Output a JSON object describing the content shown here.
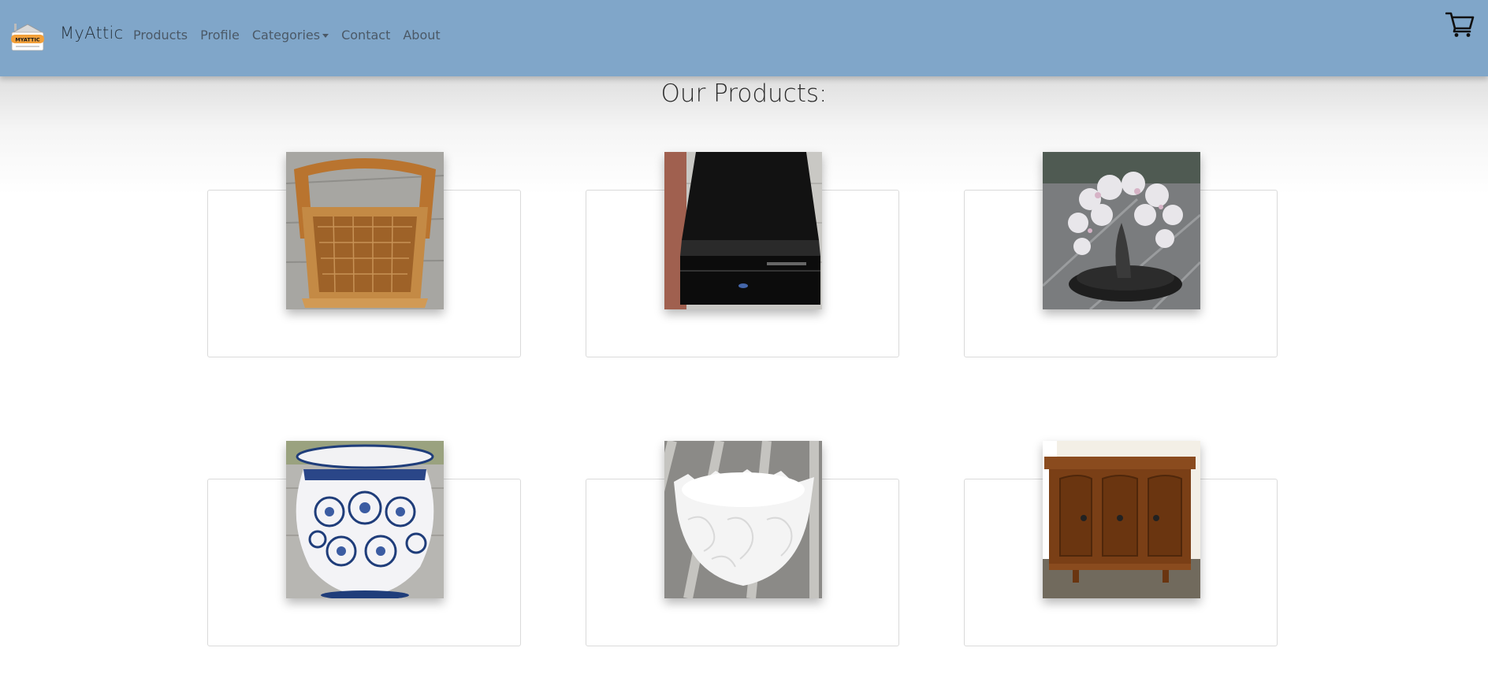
{
  "brand": {
    "name": "MyAttic",
    "logo_text": "MYATTIC"
  },
  "nav": {
    "products": "Products",
    "profile": "Profile",
    "categories": "Categories",
    "contact": "Contact",
    "about": "About"
  },
  "cart_icon": "shopping-cart-icon",
  "page": {
    "title": "Our Products:"
  },
  "products": [
    {
      "image": "wicker-basket"
    },
    {
      "image": "blu-ray-player"
    },
    {
      "image": "crystal-tree-figurine"
    },
    {
      "image": "blue-floral-vase"
    },
    {
      "image": "white-porcelain-bowl"
    },
    {
      "image": "wooden-cabinet"
    }
  ],
  "colors": {
    "navbar": "#80a6c9",
    "nav_text": "#4b5967",
    "brand_text": "#26313b",
    "card_border": "#dadada"
  }
}
